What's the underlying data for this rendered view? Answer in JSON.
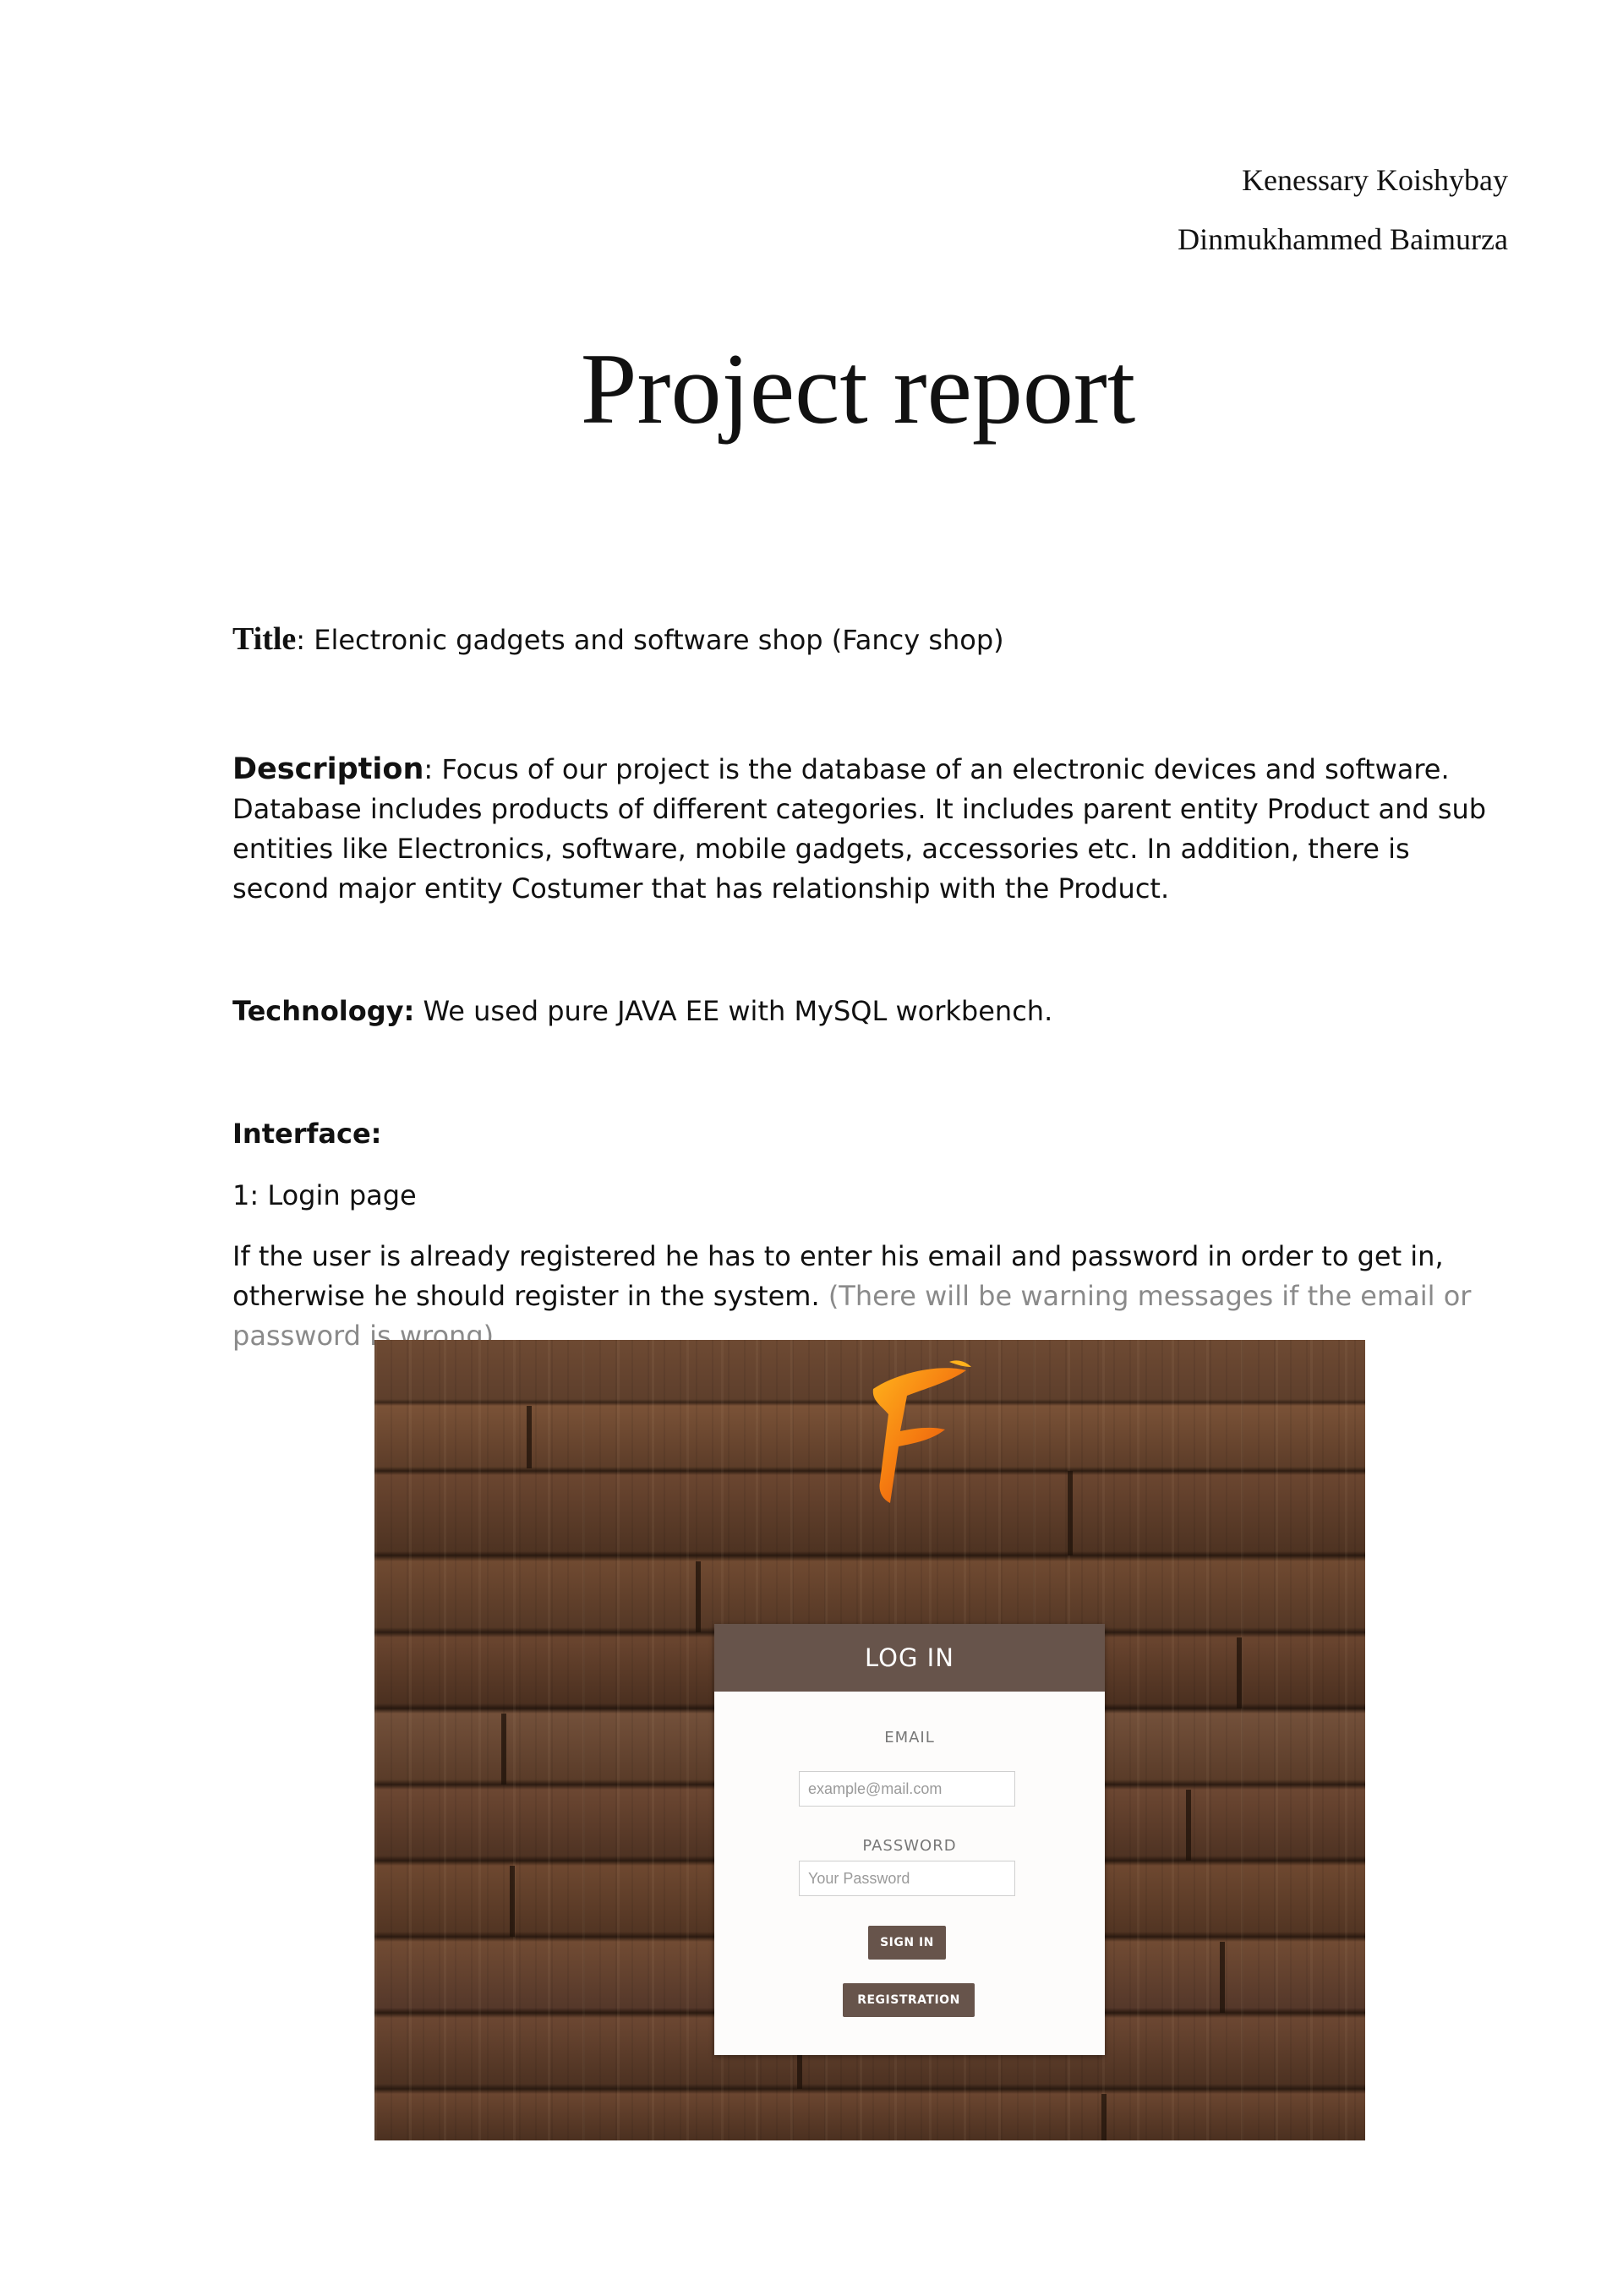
{
  "authors": [
    "Kenessary Koishybay",
    "Dinmukhammed Baimurza"
  ],
  "doc_title": "Project report",
  "title_section": {
    "label": "Title",
    "text": ": Electronic gadgets and software shop (Fancy shop)"
  },
  "description_section": {
    "label": "Description",
    "text": ": Focus of our project is the database of an electronic devices and software. Database includes products of different categories. It includes parent entity Product and sub entities like Electronics, software, mobile gadgets, accessories etc. In addition, there is second major entity Costumer that has relationship with the Product."
  },
  "technology_section": {
    "label": "Technology:",
    "text": " We used pure JAVA EE with MySQL workbench."
  },
  "interface_section": {
    "label": "Interface:",
    "item": "1: Login page",
    "text": "If the user is already registered he has to enter his email and password in order to get in, otherwise he should register in the system.",
    "note": " (There will be warning messages if the email or password is wrong)."
  },
  "login_screen": {
    "header": "LOG IN",
    "email_label": "EMAIL",
    "email_placeholder": "example@mail.com",
    "password_label": "PASSWORD",
    "password_placeholder": "Your Password",
    "sign_in_label": "SIGN IN",
    "registration_label": "REGISTRATION",
    "logo_icon": "fancy-f-logo-icon",
    "accent_color": "#67544b"
  }
}
